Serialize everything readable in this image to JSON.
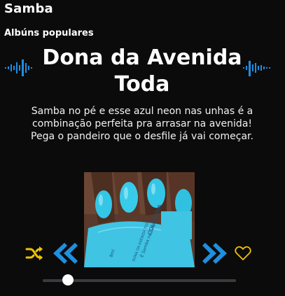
{
  "header": {
    "title": "Samba"
  },
  "section": {
    "title": "Albúns populares"
  },
  "album": {
    "title": "Dona da Avenida Toda",
    "description": "Samba no pé e esse azul neon nas unhas é a combinação perfeita pra arrasar na avenida! Pega o pandeiro que o desfile já vai começar.",
    "cover_icon": "nail-polish-cover-image",
    "bottle_label": {
      "brand": "COLORAMA",
      "line": "É Samba na Caixa",
      "name": "DONA DA AVENIDA TODA",
      "volume": "8ml"
    }
  },
  "controls": {
    "shuffle_icon": "shuffle-icon",
    "prev_icon": "skip-previous-icon",
    "next_icon": "skip-next-icon",
    "favorite_icon": "heart-outline-icon"
  },
  "progress": {
    "fraction": 0.13
  },
  "colors": {
    "background": "#0b0b0c",
    "accent_blue": "#1f8fe0",
    "accent_yellow": "#f2c200",
    "track": "#3a3a40"
  }
}
